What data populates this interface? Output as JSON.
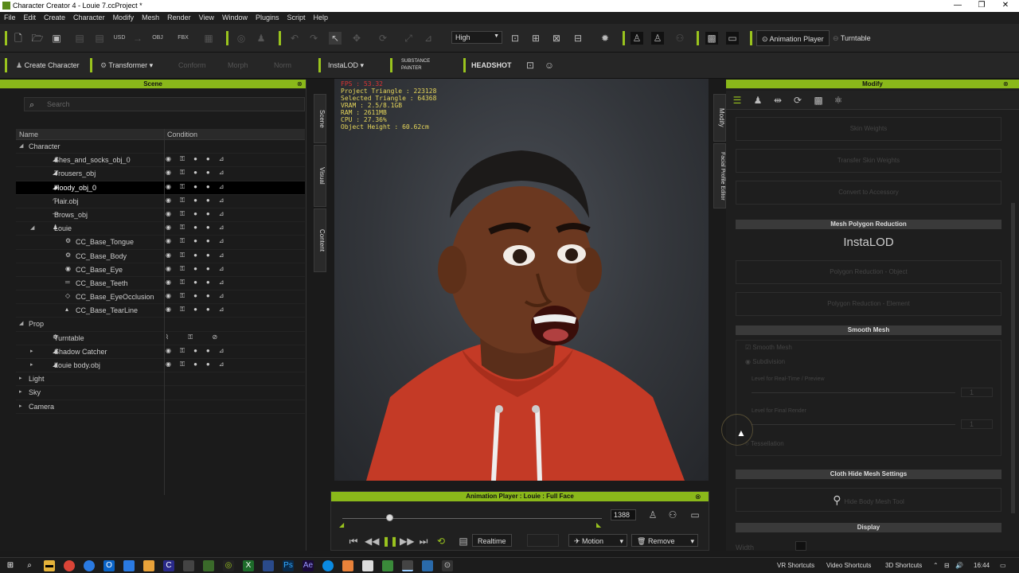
{
  "window": {
    "title": "Character Creator 4 - Louie 7.ccProject *",
    "minimize": "—",
    "restore": "❐",
    "close": "✕"
  },
  "menu": [
    "File",
    "Edit",
    "Create",
    "Character",
    "Modify",
    "Mesh",
    "Render",
    "View",
    "Window",
    "Plugins",
    "Script",
    "Help"
  ],
  "toolbar1": {
    "quality": "High",
    "animation_player": "Animation Player",
    "turntable": "Turntable"
  },
  "toolbar2": {
    "create_character": "Create Character",
    "transformer": "Transformer",
    "conform": "Conform",
    "morph": "Morph",
    "norm": "Norm",
    "instalod": "InstaLOD",
    "substance": "SUBSTANCE PAINTER",
    "headshot": "HEADSHOT"
  },
  "scene": {
    "title": "Scene",
    "search_placeholder": "Search",
    "col_name": "Name",
    "col_condition": "Condition",
    "rows": [
      {
        "name": "Character",
        "level": 0,
        "caret": "◢",
        "icon": ""
      },
      {
        "name": "Shes_and_socks_obj_0",
        "level": 1,
        "caret": "",
        "icon": "◢"
      },
      {
        "name": "Trousers_obj",
        "level": 1,
        "caret": "",
        "icon": "◢"
      },
      {
        "name": "Hoody_obj_0",
        "level": 1,
        "caret": "",
        "icon": "◢",
        "selected": true
      },
      {
        "name": "Hair.obj",
        "level": 1,
        "caret": "",
        "icon": "◠"
      },
      {
        "name": "Brows_obj",
        "level": 1,
        "caret": "",
        "icon": "—"
      },
      {
        "name": "Louie",
        "level": 1,
        "caret": "◢",
        "icon": "♟"
      },
      {
        "name": "CC_Base_Tongue",
        "level": 2,
        "caret": "",
        "icon": "⚙"
      },
      {
        "name": "CC_Base_Body",
        "level": 2,
        "caret": "",
        "icon": "⚙"
      },
      {
        "name": "CC_Base_Eye",
        "level": 2,
        "caret": "",
        "icon": "◉"
      },
      {
        "name": "CC_Base_Teeth",
        "level": 2,
        "caret": "",
        "icon": "═"
      },
      {
        "name": "CC_Base_EyeOcclusion",
        "level": 2,
        "caret": "",
        "icon": "◇"
      },
      {
        "name": "CC_Base_TearLine",
        "level": 2,
        "caret": "",
        "icon": "▴"
      },
      {
        "name": "Prop",
        "level": 0,
        "caret": "◢",
        "icon": ""
      },
      {
        "name": "Turntable",
        "level": 1,
        "caret": "",
        "icon": "☸"
      },
      {
        "name": "Shadow Catcher",
        "level": 1,
        "caret": "▸",
        "icon": "◢"
      },
      {
        "name": "Louie body.obj",
        "level": 1,
        "caret": "▸",
        "icon": "◢"
      },
      {
        "name": "Light",
        "level": 0,
        "caret": "▸",
        "icon": ""
      },
      {
        "name": "Sky",
        "level": 0,
        "caret": "▸",
        "icon": ""
      },
      {
        "name": "Camera",
        "level": 0,
        "caret": "▸",
        "icon": ""
      }
    ]
  },
  "side_tabs": {
    "scene": "Scene",
    "visual": "Visual",
    "content": "Content",
    "modify": "Modify",
    "facial": "Facial Profile Editor"
  },
  "stats": {
    "fps": "FPS : 53.32",
    "project_triangle": "Project Triangle : 223128",
    "selected_triangle": "Selected Triangle : 64368",
    "vram": "VRAM : 2.5/8.1GB",
    "ram": "RAM : 2611MB",
    "cpu": "CPU : 27.36%",
    "object_height": "Object Height : 60.62cm"
  },
  "anim_player": {
    "title": "Animation Player : Louie : Full Face",
    "frame": "1388",
    "realtime": "Realtime",
    "motion": "Motion",
    "remove": "Remove",
    "progress": 0.18
  },
  "modify": {
    "title": "Modify",
    "skin_weights": "Skin Weights",
    "transfer_skin": "Transfer Skin Weights",
    "convert_accessory": "Convert to Accessory",
    "mesh_poly_reduction": "Mesh Polygon Reduction",
    "instalod_logo": "InstaLOD",
    "poly_object": "Polygon Reduction - Object",
    "poly_element": "Polygon Reduction - Element",
    "smooth_mesh_header": "Smooth Mesh",
    "smooth_mesh_check": "Smooth Mesh",
    "subdivision": "Subdivision",
    "level_realtime": "Level for Real-Time / Preview",
    "level_final": "Level for Final Render",
    "tessellation": "Tessellation",
    "cloth_hide": "Cloth Hide Mesh Settings",
    "hide_body_mesh": "Hide Body Mesh Tool",
    "display": "Display",
    "width": "Width",
    "level_val": "1"
  },
  "taskbar": {
    "vr": "VR Shortcuts",
    "video": "Video Shortcuts",
    "3d": "3D Shortcuts",
    "time": "16:44"
  }
}
